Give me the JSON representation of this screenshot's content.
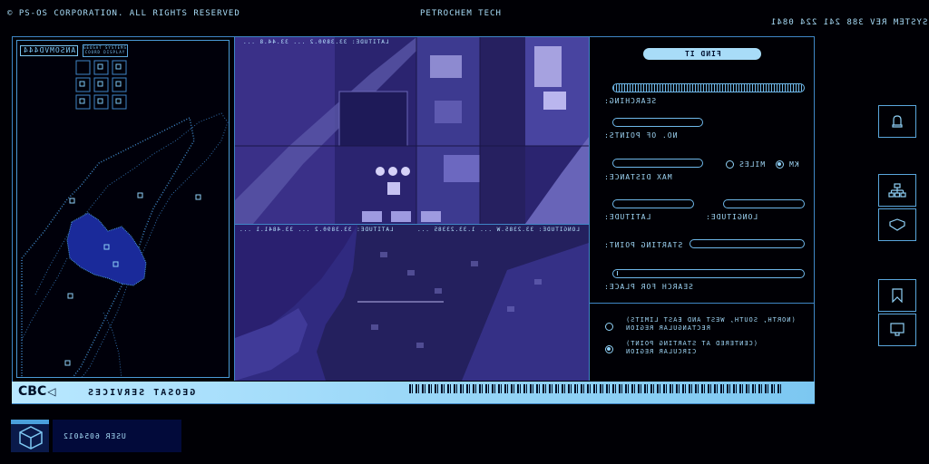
{
  "header": {
    "copyright": "© PS-OS CORPORATION. ALL RIGHTS RESERVED",
    "company": "PETROCHEM TECH",
    "system_rev": "SYSTEM REV 388 241 224 0841"
  },
  "map_panel": {
    "title": "ANSOMVD444",
    "subtitle_lines": [
      "GEOSAT SYSTEMS",
      "COORD DISPLAY"
    ]
  },
  "photos": {
    "top_coords": "LATITUDE: 33.3890.2 ... 33.44.8 ...",
    "bottom_coords_left": "LATITUDE: 33.3890.2 ... 33.4841.1 ...",
    "bottom_coords_right": "LONGITUDE: 33.2385.W ... 1.33.23385 ..."
  },
  "form": {
    "find_button": "FIND IT",
    "searching_label": "SEARCHING:",
    "searching_progress": 1.0,
    "points_label": "NO. OF POINTS:",
    "points_value": "",
    "max_distance_label": "MAX DISTANCE:",
    "max_distance_value": "",
    "unit_miles": "MILES",
    "unit_km": "KM",
    "unit_selected": "KM",
    "latitude_label": "LATITUDE:",
    "latitude_value": "",
    "longitude_label": "LONGITUDE:",
    "longitude_value": "",
    "starting_point_label": "STARTING POINT:",
    "starting_point_value": "",
    "search_label": "SEARCH FOR PLACE:",
    "search_value": ""
  },
  "region": {
    "rect_line1": "(NORTH, SOUTH, WEST AND EAST LIMITS)",
    "rect_line2": "RECTANGULAR REGION",
    "circ_line1": "(CENTERED AT STARTING POINT)",
    "circ_line2": "CIRCULAR REGION",
    "selected": "circular"
  },
  "footer": {
    "logo": "CBC",
    "service": "GEOSAT SERVICES"
  },
  "side_icons": [
    "bell-icon",
    "network-icon",
    "shield-icon",
    "bookmark-icon",
    "monitor-icon"
  ],
  "user": {
    "id": "USER 6054012"
  },
  "colors": {
    "accent": "#7ec8f2",
    "map_fill": "#1a2a9a",
    "photo_tint": "#3a2a8a",
    "background": "#000005"
  }
}
